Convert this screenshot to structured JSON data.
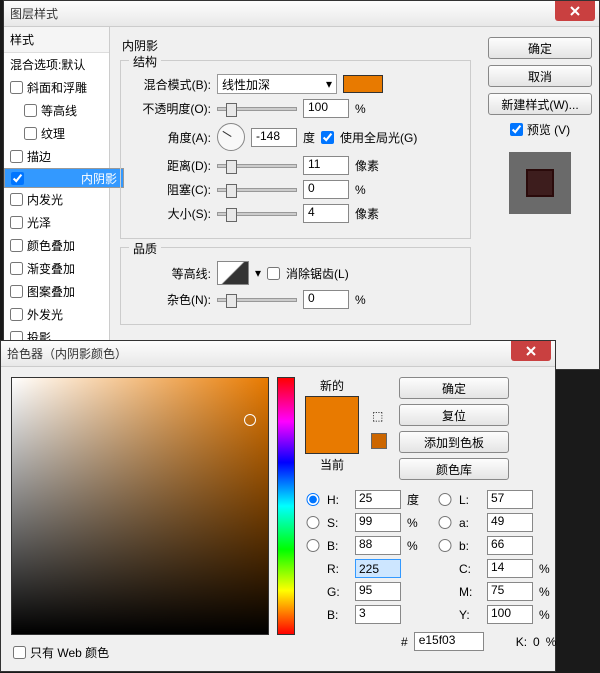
{
  "dlg1": {
    "title": "图层样式",
    "styleHeader": "样式",
    "blendDefault": "混合选项:默认",
    "styles": [
      {
        "label": "斜面和浮雕",
        "checked": false
      },
      {
        "label": "等高线",
        "checked": false,
        "indent": true
      },
      {
        "label": "纹理",
        "checked": false,
        "indent": true
      },
      {
        "label": "描边",
        "checked": false
      },
      {
        "label": "内阴影",
        "checked": true,
        "selected": true
      },
      {
        "label": "内发光",
        "checked": false
      },
      {
        "label": "光泽",
        "checked": false
      },
      {
        "label": "颜色叠加",
        "checked": false
      },
      {
        "label": "渐变叠加",
        "checked": false
      },
      {
        "label": "图案叠加",
        "checked": false
      },
      {
        "label": "外发光",
        "checked": false
      },
      {
        "label": "投影",
        "checked": false
      }
    ],
    "panelTitle": "内阴影",
    "structTitle": "结构",
    "blendModeLabel": "混合模式(B):",
    "blendModeValue": "线性加深",
    "opacityLabel": "不透明度(O):",
    "opacityValue": "100",
    "opacityUnit": "%",
    "angleLabel": "角度(A):",
    "angleValue": "-148",
    "angleUnit": "度",
    "globalLight": "使用全局光(G)",
    "distanceLabel": "距离(D):",
    "distanceValue": "11",
    "distanceUnit": "像素",
    "chokeLabel": "阻塞(C):",
    "chokeValue": "0",
    "chokeUnit": "%",
    "sizeLabel": "大小(S):",
    "sizeValue": "4",
    "sizeUnit": "像素",
    "qualityTitle": "品质",
    "contourLabel": "等高线:",
    "antiAlias": "消除锯齿(L)",
    "noiseLabel": "杂色(N):",
    "noiseValue": "0",
    "noiseUnit": "%",
    "swatchColor": "#e87a00",
    "buttons": {
      "ok": "确定",
      "cancel": "取消",
      "newStyle": "新建样式(W)...",
      "preview": "预览 (V)"
    }
  },
  "dlg2": {
    "title": "拾色器（内阴影颜色）",
    "newLabel": "新的",
    "curLabel": "当前",
    "newColor": "#e87a00",
    "curColor": "#e87a00",
    "smallColor": "#cc6600",
    "buttons": {
      "ok": "确定",
      "reset": "复位",
      "addSwatch": "添加到色板",
      "colorLib": "颜色库"
    },
    "H": {
      "l": "H:",
      "v": "25",
      "u": "度"
    },
    "S": {
      "l": "S:",
      "v": "99",
      "u": "%"
    },
    "Bv": {
      "l": "B:",
      "v": "88",
      "u": "%"
    },
    "R": {
      "l": "R:",
      "v": "225"
    },
    "G": {
      "l": "G:",
      "v": "95"
    },
    "B": {
      "l": "B:",
      "v": "3"
    },
    "L": {
      "l": "L:",
      "v": "57"
    },
    "a": {
      "l": "a:",
      "v": "49"
    },
    "b": {
      "l": "b:",
      "v": "66"
    },
    "C": {
      "l": "C:",
      "v": "14",
      "u": "%"
    },
    "M": {
      "l": "M:",
      "v": "75",
      "u": "%"
    },
    "Y": {
      "l": "Y:",
      "v": "100",
      "u": "%"
    },
    "K": {
      "l": "K:",
      "v": "0",
      "u": "%"
    },
    "hexLabel": "#",
    "hexValue": "e15f03",
    "webOnly": "只有 Web 颜色"
  }
}
